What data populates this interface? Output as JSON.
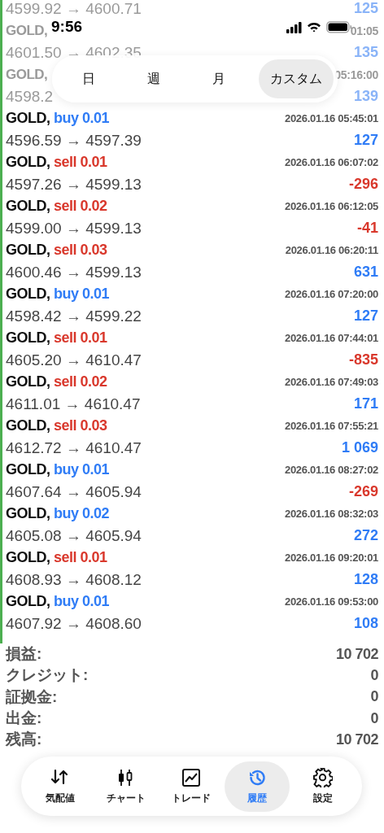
{
  "status_bar": {
    "time": "9:56"
  },
  "period_tabs": [
    {
      "label": "日",
      "selected": false
    },
    {
      "label": "週",
      "selected": false
    },
    {
      "label": "月",
      "selected": false
    },
    {
      "label": "カスタム",
      "selected": true
    }
  ],
  "deals": [
    {
      "faded": true,
      "prices": "4599.92 → 4600.71",
      "profit": "125",
      "color": "#8ab4f8"
    },
    {
      "faded": true,
      "symbol": "GOLD,",
      "time": "01:05",
      "prices": "4601.50 → 4602.35",
      "profit": "135",
      "color": "#8ab4f8"
    },
    {
      "faded": true,
      "symbol": "GOLD,",
      "time": "05:16:00",
      "prices": "4598.2",
      "profit": "139",
      "color": "#8ab4f8"
    },
    {
      "faded": false,
      "symbol": "GOLD,",
      "kind": "buy",
      "order": "buy 0.01",
      "time": "2026.01.16 05:45:01",
      "prices": "4596.59 → 4597.39",
      "profit": "127",
      "color": "#2f7cf6"
    },
    {
      "faded": false,
      "symbol": "GOLD,",
      "kind": "sell",
      "order": "sell 0.01",
      "time": "2026.01.16 06:07:02",
      "prices": "4597.26 → 4599.13",
      "profit": "-296",
      "color": "#d9382c"
    },
    {
      "faded": false,
      "symbol": "GOLD,",
      "kind": "sell",
      "order": "sell 0.02",
      "time": "2026.01.16 06:12:05",
      "prices": "4599.00 → 4599.13",
      "profit": "-41",
      "color": "#d9382c"
    },
    {
      "faded": false,
      "symbol": "GOLD,",
      "kind": "sell",
      "order": "sell 0.03",
      "time": "2026.01.16 06:20:11",
      "prices": "4600.46 → 4599.13",
      "profit": "631",
      "color": "#2f7cf6"
    },
    {
      "faded": false,
      "symbol": "GOLD,",
      "kind": "buy",
      "order": "buy 0.01",
      "time": "2026.01.16 07:20:00",
      "prices": "4598.42 → 4599.22",
      "profit": "127",
      "color": "#2f7cf6"
    },
    {
      "faded": false,
      "symbol": "GOLD,",
      "kind": "sell",
      "order": "sell 0.01",
      "time": "2026.01.16 07:44:01",
      "prices": "4605.20 → 4610.47",
      "profit": "-835",
      "color": "#d9382c"
    },
    {
      "faded": false,
      "symbol": "GOLD,",
      "kind": "sell",
      "order": "sell 0.02",
      "time": "2026.01.16 07:49:03",
      "prices": "4611.01 → 4610.47",
      "profit": "171",
      "color": "#2f7cf6"
    },
    {
      "faded": false,
      "symbol": "GOLD,",
      "kind": "sell",
      "order": "sell 0.03",
      "time": "2026.01.16 07:55:21",
      "prices": "4612.72 → 4610.47",
      "profit": "1 069",
      "color": "#2f7cf6"
    },
    {
      "faded": false,
      "symbol": "GOLD,",
      "kind": "buy",
      "order": "buy 0.01",
      "time": "2026.01.16 08:27:02",
      "prices": "4607.64 → 4605.94",
      "profit": "-269",
      "color": "#d9382c"
    },
    {
      "faded": false,
      "symbol": "GOLD,",
      "kind": "buy",
      "order": "buy 0.02",
      "time": "2026.01.16 08:32:03",
      "prices": "4605.08 → 4605.94",
      "profit": "272",
      "color": "#2f7cf6"
    },
    {
      "faded": false,
      "symbol": "GOLD,",
      "kind": "sell",
      "order": "sell 0.01",
      "time": "2026.01.16 09:20:01",
      "prices": "4608.93 → 4608.12",
      "profit": "128",
      "color": "#2f7cf6"
    },
    {
      "faded": false,
      "symbol": "GOLD,",
      "kind": "buy",
      "order": "buy 0.01",
      "time": "2026.01.16 09:53:00",
      "prices": "4607.92 → 4608.60",
      "profit": "108",
      "color": "#2f7cf6"
    }
  ],
  "summary": [
    {
      "label": "損益:",
      "value": "10 702"
    },
    {
      "label": "クレジット:",
      "value": "0"
    },
    {
      "label": "証拠金:",
      "value": "0"
    },
    {
      "label": "出金:",
      "value": "0"
    },
    {
      "label": "残高:",
      "value": "10 702"
    }
  ],
  "tab_bar": [
    {
      "kind": "quotes",
      "label": "気配値",
      "selected": false
    },
    {
      "kind": "chart",
      "label": "チャート",
      "selected": false
    },
    {
      "kind": "trade",
      "label": "トレード",
      "selected": false
    },
    {
      "kind": "history",
      "label": "履歴",
      "selected": true
    },
    {
      "kind": "settings",
      "label": "設定",
      "selected": false
    }
  ]
}
